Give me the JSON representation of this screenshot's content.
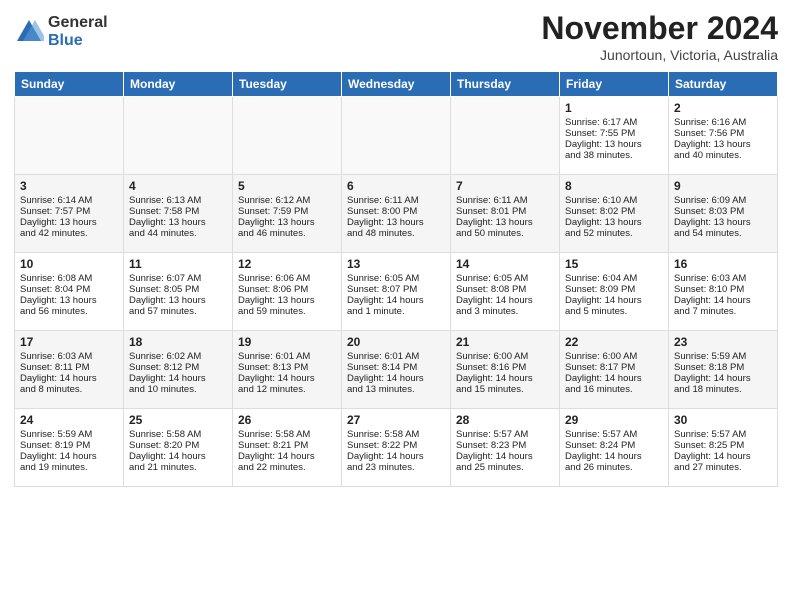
{
  "header": {
    "logo_general": "General",
    "logo_blue": "Blue",
    "month_title": "November 2024",
    "subtitle": "Junortoun, Victoria, Australia"
  },
  "days_of_week": [
    "Sunday",
    "Monday",
    "Tuesday",
    "Wednesday",
    "Thursday",
    "Friday",
    "Saturday"
  ],
  "weeks": [
    [
      {
        "day": "",
        "content": ""
      },
      {
        "day": "",
        "content": ""
      },
      {
        "day": "",
        "content": ""
      },
      {
        "day": "",
        "content": ""
      },
      {
        "day": "",
        "content": ""
      },
      {
        "day": "1",
        "content": "Sunrise: 6:17 AM\nSunset: 7:55 PM\nDaylight: 13 hours\nand 38 minutes."
      },
      {
        "day": "2",
        "content": "Sunrise: 6:16 AM\nSunset: 7:56 PM\nDaylight: 13 hours\nand 40 minutes."
      }
    ],
    [
      {
        "day": "3",
        "content": "Sunrise: 6:14 AM\nSunset: 7:57 PM\nDaylight: 13 hours\nand 42 minutes."
      },
      {
        "day": "4",
        "content": "Sunrise: 6:13 AM\nSunset: 7:58 PM\nDaylight: 13 hours\nand 44 minutes."
      },
      {
        "day": "5",
        "content": "Sunrise: 6:12 AM\nSunset: 7:59 PM\nDaylight: 13 hours\nand 46 minutes."
      },
      {
        "day": "6",
        "content": "Sunrise: 6:11 AM\nSunset: 8:00 PM\nDaylight: 13 hours\nand 48 minutes."
      },
      {
        "day": "7",
        "content": "Sunrise: 6:11 AM\nSunset: 8:01 PM\nDaylight: 13 hours\nand 50 minutes."
      },
      {
        "day": "8",
        "content": "Sunrise: 6:10 AM\nSunset: 8:02 PM\nDaylight: 13 hours\nand 52 minutes."
      },
      {
        "day": "9",
        "content": "Sunrise: 6:09 AM\nSunset: 8:03 PM\nDaylight: 13 hours\nand 54 minutes."
      }
    ],
    [
      {
        "day": "10",
        "content": "Sunrise: 6:08 AM\nSunset: 8:04 PM\nDaylight: 13 hours\nand 56 minutes."
      },
      {
        "day": "11",
        "content": "Sunrise: 6:07 AM\nSunset: 8:05 PM\nDaylight: 13 hours\nand 57 minutes."
      },
      {
        "day": "12",
        "content": "Sunrise: 6:06 AM\nSunset: 8:06 PM\nDaylight: 13 hours\nand 59 minutes."
      },
      {
        "day": "13",
        "content": "Sunrise: 6:05 AM\nSunset: 8:07 PM\nDaylight: 14 hours\nand 1 minute."
      },
      {
        "day": "14",
        "content": "Sunrise: 6:05 AM\nSunset: 8:08 PM\nDaylight: 14 hours\nand 3 minutes."
      },
      {
        "day": "15",
        "content": "Sunrise: 6:04 AM\nSunset: 8:09 PM\nDaylight: 14 hours\nand 5 minutes."
      },
      {
        "day": "16",
        "content": "Sunrise: 6:03 AM\nSunset: 8:10 PM\nDaylight: 14 hours\nand 7 minutes."
      }
    ],
    [
      {
        "day": "17",
        "content": "Sunrise: 6:03 AM\nSunset: 8:11 PM\nDaylight: 14 hours\nand 8 minutes."
      },
      {
        "day": "18",
        "content": "Sunrise: 6:02 AM\nSunset: 8:12 PM\nDaylight: 14 hours\nand 10 minutes."
      },
      {
        "day": "19",
        "content": "Sunrise: 6:01 AM\nSunset: 8:13 PM\nDaylight: 14 hours\nand 12 minutes."
      },
      {
        "day": "20",
        "content": "Sunrise: 6:01 AM\nSunset: 8:14 PM\nDaylight: 14 hours\nand 13 minutes."
      },
      {
        "day": "21",
        "content": "Sunrise: 6:00 AM\nSunset: 8:16 PM\nDaylight: 14 hours\nand 15 minutes."
      },
      {
        "day": "22",
        "content": "Sunrise: 6:00 AM\nSunset: 8:17 PM\nDaylight: 14 hours\nand 16 minutes."
      },
      {
        "day": "23",
        "content": "Sunrise: 5:59 AM\nSunset: 8:18 PM\nDaylight: 14 hours\nand 18 minutes."
      }
    ],
    [
      {
        "day": "24",
        "content": "Sunrise: 5:59 AM\nSunset: 8:19 PM\nDaylight: 14 hours\nand 19 minutes."
      },
      {
        "day": "25",
        "content": "Sunrise: 5:58 AM\nSunset: 8:20 PM\nDaylight: 14 hours\nand 21 minutes."
      },
      {
        "day": "26",
        "content": "Sunrise: 5:58 AM\nSunset: 8:21 PM\nDaylight: 14 hours\nand 22 minutes."
      },
      {
        "day": "27",
        "content": "Sunrise: 5:58 AM\nSunset: 8:22 PM\nDaylight: 14 hours\nand 23 minutes."
      },
      {
        "day": "28",
        "content": "Sunrise: 5:57 AM\nSunset: 8:23 PM\nDaylight: 14 hours\nand 25 minutes."
      },
      {
        "day": "29",
        "content": "Sunrise: 5:57 AM\nSunset: 8:24 PM\nDaylight: 14 hours\nand 26 minutes."
      },
      {
        "day": "30",
        "content": "Sunrise: 5:57 AM\nSunset: 8:25 PM\nDaylight: 14 hours\nand 27 minutes."
      }
    ]
  ]
}
